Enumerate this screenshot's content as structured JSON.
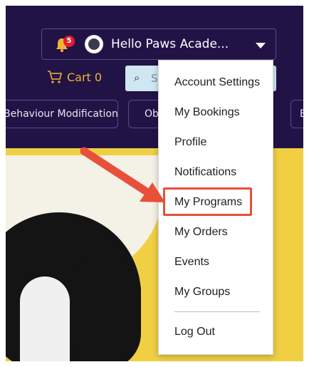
{
  "header": {
    "notification_count": "5",
    "greeting": "Hello Paws Acade...",
    "cart_label": "Cart 0",
    "search_text": "S",
    "categories": [
      "Behaviour Modification",
      "Ob",
      "Bo"
    ]
  },
  "menu": {
    "items": [
      "Account Settings",
      "My Bookings",
      "Profile",
      "Notifications",
      "My Programs",
      "My Orders",
      "Events",
      "My Groups"
    ],
    "logout": "Log Out",
    "highlighted_item": "My Programs"
  },
  "colors": {
    "header_bg": "#221346",
    "cart_accent": "#f2b234",
    "badge": "#e01e2f",
    "highlight": "#e8503a",
    "search_bg": "#cfe7f3"
  },
  "icons": [
    "bell-icon",
    "avatar-logo",
    "chevron-down-icon",
    "cart-icon",
    "search-icon",
    "arrow-annotation"
  ]
}
